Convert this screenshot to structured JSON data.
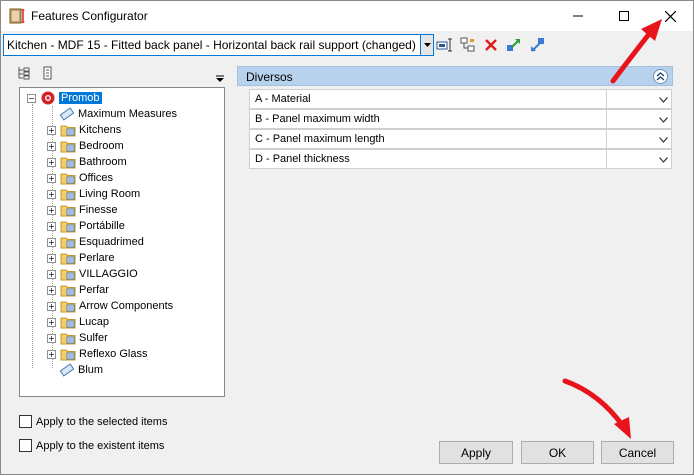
{
  "window": {
    "title": "Features Configurator",
    "controls": {
      "minimize": "—",
      "maximize": "☐",
      "close": "✕"
    }
  },
  "toolbar": {
    "combo_value": "Kitchen - MDF 15 - Fitted back panel - Horizontal back rail support (changed)",
    "icons": [
      "edit-icon",
      "hierarchy-icon",
      "delete-icon",
      "export-icon",
      "import-icon"
    ]
  },
  "tree": {
    "root": "Promob",
    "items": [
      {
        "label": "Maximum Measures",
        "expandable": false,
        "icon": "measure"
      },
      {
        "label": "Kitchens",
        "expandable": true,
        "icon": "folder"
      },
      {
        "label": "Bedroom",
        "expandable": true,
        "icon": "folder"
      },
      {
        "label": "Bathroom",
        "expandable": true,
        "icon": "folder"
      },
      {
        "label": "Offices",
        "expandable": true,
        "icon": "folder"
      },
      {
        "label": "Living Room",
        "expandable": true,
        "icon": "folder"
      },
      {
        "label": "Finesse",
        "expandable": true,
        "icon": "folder"
      },
      {
        "label": "Portábille",
        "expandable": true,
        "icon": "folder"
      },
      {
        "label": "Esquadrimed",
        "expandable": true,
        "icon": "folder"
      },
      {
        "label": "Perlare",
        "expandable": true,
        "icon": "folder"
      },
      {
        "label": "VILLAGGIO",
        "expandable": true,
        "icon": "folder"
      },
      {
        "label": "Perfar",
        "expandable": true,
        "icon": "folder"
      },
      {
        "label": "Arrow Components",
        "expandable": true,
        "icon": "folder"
      },
      {
        "label": "Lucap",
        "expandable": true,
        "icon": "folder"
      },
      {
        "label": "Sulfer",
        "expandable": true,
        "icon": "folder"
      },
      {
        "label": "Reflexo Glass",
        "expandable": true,
        "icon": "folder"
      },
      {
        "label": "Blum",
        "expandable": false,
        "icon": "measure"
      }
    ]
  },
  "options": {
    "apply_selected": "Apply to the selected items",
    "apply_existent": "Apply to the existent items"
  },
  "group": {
    "title": "Diversos",
    "rows": [
      {
        "label": "A - Material",
        "value": ""
      },
      {
        "label": "B - Panel maximum width",
        "value": ""
      },
      {
        "label": "C - Panel maximum length",
        "value": ""
      },
      {
        "label": "D - Panel thickness",
        "value": ""
      }
    ]
  },
  "buttons": {
    "apply": "Apply",
    "ok": "OK",
    "cancel": "Cancel"
  },
  "colors": {
    "accent": "#0078d7",
    "group_header": "#b7d2ec",
    "annotation_arrow": "#e8141c"
  }
}
